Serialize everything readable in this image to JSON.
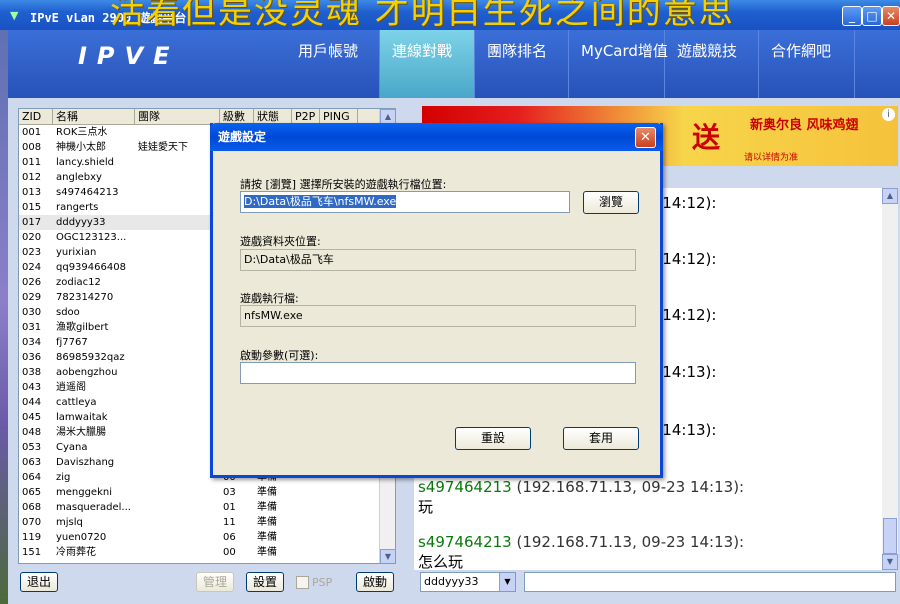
{
  "window": {
    "title": "IPvE vLan 2900 遊戲平台",
    "overlay_text": "活着但是没灵魂 才明白生死之间的意思"
  },
  "header": {
    "logo": "IPVE",
    "nav": [
      {
        "label": "用戶帳號"
      },
      {
        "label": "連線對戰"
      },
      {
        "label": "團隊排名"
      },
      {
        "label": "MyCard增值"
      },
      {
        "label": "遊戲競技"
      },
      {
        "label": "合作網吧"
      }
    ]
  },
  "userlist": {
    "columns": [
      "ZID",
      "名稱",
      "團隊",
      "級數",
      "狀態",
      "P2P",
      "PING"
    ],
    "rows": [
      {
        "zid": "001",
        "name": "ROK三点水",
        "team": "",
        "lv": "",
        "st": ""
      },
      {
        "zid": "008",
        "name": "神機小太郎",
        "team": "娃娃愛天下",
        "lv": "",
        "st": ""
      },
      {
        "zid": "011",
        "name": "lancy.shield",
        "team": "",
        "lv": "",
        "st": ""
      },
      {
        "zid": "012",
        "name": "anglebxy",
        "team": "",
        "lv": "",
        "st": ""
      },
      {
        "zid": "013",
        "name": "s497464213",
        "team": "",
        "lv": "",
        "st": ""
      },
      {
        "zid": "015",
        "name": "rangerts",
        "team": "",
        "lv": "",
        "st": ""
      },
      {
        "zid": "017",
        "name": "dddyyy33",
        "team": "",
        "lv": "",
        "st": ""
      },
      {
        "zid": "020",
        "name": "OGC123123...",
        "team": "",
        "lv": "",
        "st": ""
      },
      {
        "zid": "023",
        "name": "yurixian",
        "team": "",
        "lv": "",
        "st": ""
      },
      {
        "zid": "024",
        "name": "qq939466408",
        "team": "",
        "lv": "",
        "st": ""
      },
      {
        "zid": "026",
        "name": "zodiac12",
        "team": "",
        "lv": "",
        "st": ""
      },
      {
        "zid": "029",
        "name": "782314270",
        "team": "",
        "lv": "",
        "st": ""
      },
      {
        "zid": "030",
        "name": "sdoo",
        "team": "",
        "lv": "",
        "st": ""
      },
      {
        "zid": "031",
        "name": "渔歌gilbert",
        "team": "",
        "lv": "",
        "st": ""
      },
      {
        "zid": "034",
        "name": "fj7767",
        "team": "",
        "lv": "",
        "st": ""
      },
      {
        "zid": "036",
        "name": "86985932qaz",
        "team": "",
        "lv": "",
        "st": ""
      },
      {
        "zid": "038",
        "name": "aobengzhou",
        "team": "",
        "lv": "",
        "st": ""
      },
      {
        "zid": "043",
        "name": "逍遥阁",
        "team": "",
        "lv": "",
        "st": ""
      },
      {
        "zid": "044",
        "name": "cattleya",
        "team": "",
        "lv": "",
        "st": ""
      },
      {
        "zid": "045",
        "name": "lamwaitak",
        "team": "",
        "lv": "",
        "st": ""
      },
      {
        "zid": "048",
        "name": "湯米大臘腸",
        "team": "",
        "lv": "",
        "st": ""
      },
      {
        "zid": "053",
        "name": "Cyana",
        "team": "",
        "lv": "",
        "st": ""
      },
      {
        "zid": "063",
        "name": "Daviszhang",
        "team": "",
        "lv": "",
        "st": ""
      },
      {
        "zid": "064",
        "name": "zig",
        "team": "",
        "lv": "00",
        "st": "準備"
      },
      {
        "zid": "065",
        "name": "menggekni",
        "team": "",
        "lv": "03",
        "st": "準備"
      },
      {
        "zid": "068",
        "name": "masqueradel...",
        "team": "",
        "lv": "01",
        "st": "準備"
      },
      {
        "zid": "070",
        "name": "mjslq",
        "team": "",
        "lv": "11",
        "st": "準備"
      },
      {
        "zid": "119",
        "name": "yuen0720",
        "team": "",
        "lv": "06",
        "st": "準備"
      },
      {
        "zid": "151",
        "name": "冷雨葬花",
        "team": "",
        "lv": "00",
        "st": "準備"
      }
    ],
    "buttons": {
      "exit": "退出",
      "manage": "管理",
      "settings": "設置",
      "psp": "PSP",
      "start": "啟動"
    }
  },
  "ad": {
    "main": "送",
    "sub1": "新奥尔良 风味鸡翅",
    "sub2": "请以详情为准"
  },
  "chat": {
    "partial_times": [
      "3 14:12):",
      "3 14:12):",
      "3 14:12):",
      "3 14:13):",
      "3 14:13):"
    ],
    "messages": [
      {
        "who": "s497464213",
        "meta": " (192.168.71.13, 09-23 14:13):",
        "body": "玩"
      },
      {
        "who": "s497464213",
        "meta": " (192.168.71.13, 09-23 14:13):",
        "body": "怎么玩"
      }
    ],
    "user_combo": "dddyyy33",
    "input_value": ""
  },
  "dialog": {
    "title": "遊戲設定",
    "exe_label": "請按 [瀏覽] 選擇所安裝的遊戲執行檔位置:",
    "exe_value": "D:\\Data\\极品飞车\\nfsMW.exe",
    "browse": "瀏覽",
    "folder_label": "遊戲資料夾位置:",
    "folder_value": "D:\\Data\\极品飞车",
    "file_label": "遊戲執行檔:",
    "file_value": "nfsMW.exe",
    "args_label": "啟動參數(可選):",
    "args_value": "",
    "reset": "重設",
    "apply": "套用"
  }
}
